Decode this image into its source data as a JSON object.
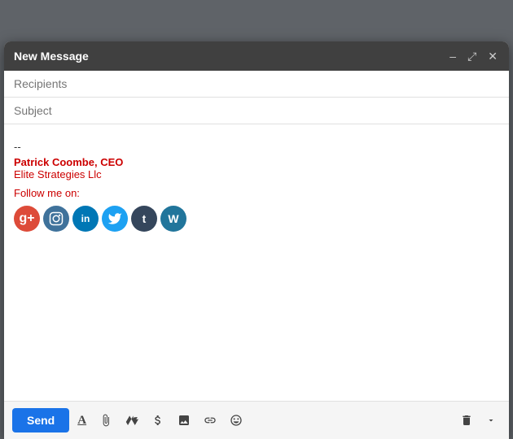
{
  "window": {
    "title": "New Message",
    "minimize_label": "–",
    "expand_label": "⤢",
    "close_label": "✕"
  },
  "fields": {
    "recipients_placeholder": "Recipients",
    "subject_placeholder": "Subject"
  },
  "signature": {
    "separator": "--",
    "name": "Patrick Coombe, CEO",
    "company": "Elite Strategies Llc",
    "follow_label": "Follow me on:"
  },
  "social_icons": [
    {
      "name": "google-plus",
      "label": "g+",
      "css_class": "icon-gplus"
    },
    {
      "name": "instagram",
      "label": "📷",
      "css_class": "icon-instagram"
    },
    {
      "name": "linkedin",
      "label": "in",
      "css_class": "icon-linkedin"
    },
    {
      "name": "twitter",
      "label": "t",
      "css_class": "icon-twitter"
    },
    {
      "name": "tumblr",
      "label": "t",
      "css_class": "icon-tumblr"
    },
    {
      "name": "wordpress",
      "label": "W",
      "css_class": "icon-wordpress"
    }
  ],
  "toolbar": {
    "send_label": "Send",
    "formatting_label": "A",
    "attach_label": "📎",
    "drive_label": "▲",
    "dollar_label": "$",
    "photo_label": "🖼",
    "link_label": "🔗",
    "emoji_label": "☺",
    "delete_label": "🗑",
    "more_label": "▾"
  }
}
